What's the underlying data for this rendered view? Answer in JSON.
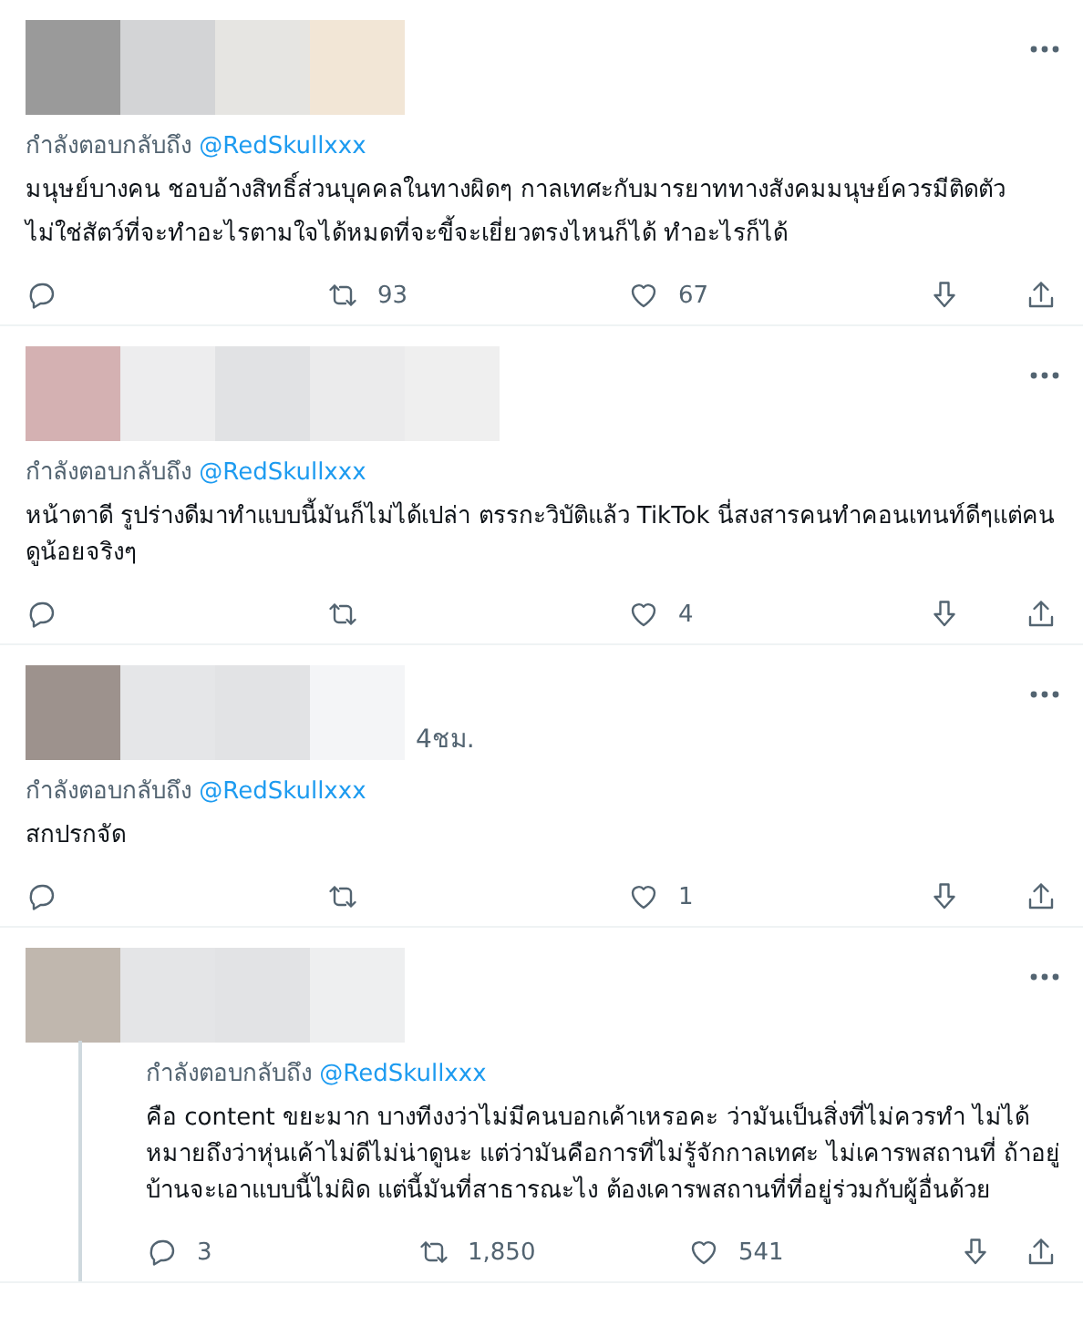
{
  "tweets": [
    {
      "threaded": false,
      "reply_prefix": "กำลังตอบกลับถึง",
      "reply_handle": "@RedSkullxxx",
      "text": [
        "มนุษย์บางคน ชอบอ้างสิทธิ์ส่วนบุคคลในทางผิดๆ กาลเทศะกับมารยาททางสังคมมนุษย์ควรมีติดตัว",
        "ไม่ใช่สัตว์ที่จะทำอะไรตามใจได้หมดที่จะขี้จะเยี่ยวตรงไหนก็ได้ ทำอะไรก็ได้"
      ],
      "retweets": "93",
      "likes": "67"
    },
    {
      "threaded": false,
      "reply_prefix": "กำลังตอบกลับถึง",
      "reply_handle": "@RedSkullxxx",
      "text": [
        "หน้าตาดี รูปร่างดีมาทำแบบนี้มันก็ไม่ได้เปล่า ตรรกะวิบัติแล้ว TikTok นี่สงสารคนทำคอนเทนท์ดีๆแต่คนดูน้อยจริงๆ"
      ],
      "likes": "4"
    },
    {
      "threaded": false,
      "time": "4ชม.",
      "reply_prefix": "กำลังตอบกลับถึง",
      "reply_handle": "@RedSkullxxx",
      "text": [
        "สกปรกจัด"
      ],
      "likes": "1"
    },
    {
      "threaded": true,
      "reply_prefix": "กำลังตอบกลับถึง",
      "reply_handle": "@RedSkullxxx",
      "text": [
        "คือ content ขยะมาก บางทีงงว่าไม่มีคนบอกเค้าเหรอคะ ว่ามันเป็นสิ่งที่ไม่ควรทำ ไม่ได้หมายถึงว่าหุ่นเค้าไม่ดีไม่น่าดูนะ แต่ว่ามันคือการที่ไม่รู้จักกาลเทศะ ไม่เคารพสถานที่ ถ้าอยู่บ้านจะเอาแบบนี้ไม่ผิด แต่นี้มันที่สาธารณะไง ต้องเคารพสถานที่ที่อยู่ร่วมกับผู้อื่นด้วย"
      ],
      "replies": "3",
      "retweets": "1,850",
      "likes": "541"
    }
  ]
}
